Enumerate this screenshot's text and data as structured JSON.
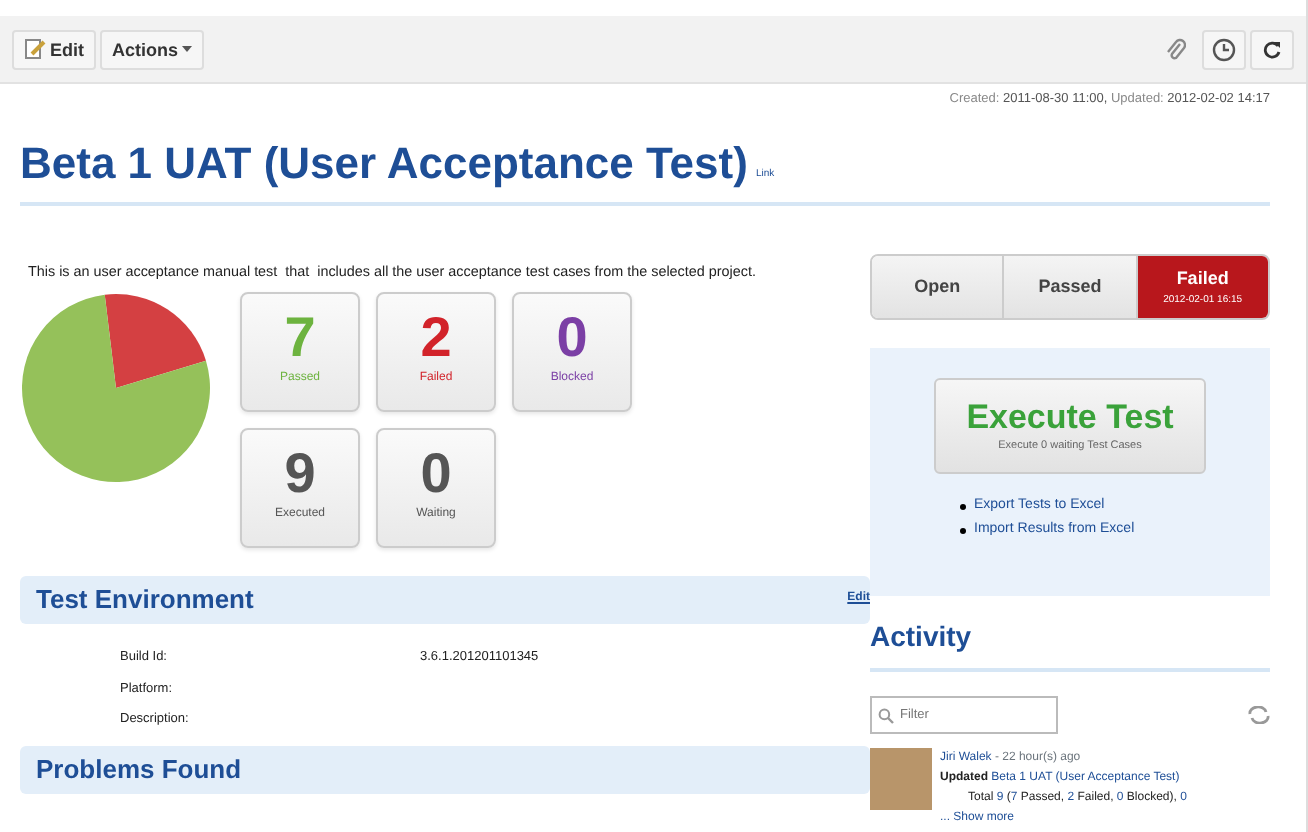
{
  "toolbar": {
    "buttons": [
      "Edit",
      "Actions"
    ]
  },
  "meta": [
    {
      "label": "Created:",
      "value": "2011-08-30 11:00,"
    },
    {
      "label": "Updated:",
      "value": "2012-02-02 14:17"
    }
  ],
  "title": "Beta 1 UAT (User Acceptance Test)",
  "title_link": "Link",
  "description": "This is an user acceptance manual test  that  includes all the user acceptance test cases from the selected project.",
  "stats": [
    {
      "value": "7",
      "label": "Passed",
      "color": "#6db33f"
    },
    {
      "value": "2",
      "label": "Failed",
      "color": "#d2232a"
    },
    {
      "value": "0",
      "label": "Blocked",
      "color": "#7b3fa5"
    },
    {
      "value": "9",
      "label": "Executed",
      "color": "#555555"
    },
    {
      "value": "0",
      "label": "Waiting",
      "color": "#555555"
    }
  ],
  "status_tabs": [
    {
      "label": "Open",
      "selected": false
    },
    {
      "label": "Passed",
      "selected": false
    },
    {
      "label": "Failed",
      "selected": true,
      "date": "2012-02-01 16:15"
    }
  ],
  "execute": {
    "label": "Execute Test",
    "sub": "Execute 0 waiting Test Cases",
    "links": [
      "Export Tests to Excel",
      "Import Results from Excel"
    ]
  },
  "environment": {
    "title": "Test Environment",
    "edit": "Edit",
    "fields": [
      {
        "label": "Build Id:",
        "value": "3.6.1.201201101345"
      },
      {
        "label": "Platform:"
      },
      {
        "label": "Description:"
      }
    ]
  },
  "problems": {
    "title": "Problems Found"
  },
  "activity": {
    "title": "Activity",
    "filter_placeholder": "Filter",
    "entries": [
      {
        "user": "Jiri Walek",
        "time": " - 22 hour(s) ago",
        "action": "Updated",
        "target": "Beta 1 UAT (User Acceptance Test)",
        "summary": [
          {
            "text": "Total ",
            "link": false
          },
          {
            "text": "9",
            "link": true
          },
          {
            "text": " (",
            "link": false
          },
          {
            "text": "7",
            "link": true
          },
          {
            "text": " Passed, ",
            "link": false
          },
          {
            "text": "2",
            "link": true
          },
          {
            "text": " Failed, ",
            "link": false
          },
          {
            "text": "0",
            "link": true
          },
          {
            "text": " Blocked), ",
            "link": false
          },
          {
            "text": "0",
            "link": true
          }
        ],
        "more": "... Show more"
      }
    ]
  }
}
